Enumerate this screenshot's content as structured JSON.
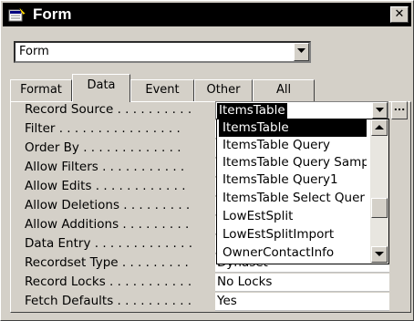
{
  "window": {
    "title": "Form",
    "close_glyph": "✕"
  },
  "object_selector": {
    "value": "Form"
  },
  "tabs": [
    {
      "label": "Format",
      "active": false
    },
    {
      "label": "Data",
      "active": true
    },
    {
      "label": "Event",
      "active": false
    },
    {
      "label": "Other",
      "active": false
    },
    {
      "label": "All",
      "active": false
    }
  ],
  "properties": [
    {
      "label": "Record Source . . . . . . . . . .",
      "value": "ItemsTable"
    },
    {
      "label": "Filter . . . . . . . . . . . . . . . .",
      "value": ""
    },
    {
      "label": "Order By . . . . . . . . . . . . .",
      "value": ""
    },
    {
      "label": "Allow Filters . . . . . . . . . . .",
      "value": ""
    },
    {
      "label": "Allow Edits . . . . . . . . . . . .",
      "value": ""
    },
    {
      "label": "Allow Deletions . . . . . . . . .",
      "value": ""
    },
    {
      "label": "Allow Additions . . . . . . . . .",
      "value": ""
    },
    {
      "label": "Data Entry . . . . . . . . . . . . .",
      "value": ""
    },
    {
      "label": "Recordset Type . . . . . . . . .",
      "value": "Dynaset"
    },
    {
      "label": "Record Locks . . . . . . . . . . .",
      "value": "No Locks"
    },
    {
      "label": "Fetch Defaults . . . . . . . . . .",
      "value": "Yes"
    }
  ],
  "record_source_dropdown": {
    "builder_label": "...",
    "items": [
      "ItemsTable",
      "ItemsTable Query",
      "ItemsTable Query Samp",
      "ItemsTable Query1",
      "ItemsTable Select Quer",
      "LowEstSplit",
      "LowEstSplitImport",
      "OwnerContactInfo"
    ],
    "selected_index": 0
  },
  "icons": {
    "window_icon": "form-icon",
    "dropdown_arrow": "chevron-down-icon",
    "scroll_up": "scroll-up-arrow-icon",
    "scroll_down": "scroll-down-arrow-icon"
  },
  "colors": {
    "title_bar": "#000000",
    "face": "#d4d0c8",
    "selection": "#000000"
  }
}
